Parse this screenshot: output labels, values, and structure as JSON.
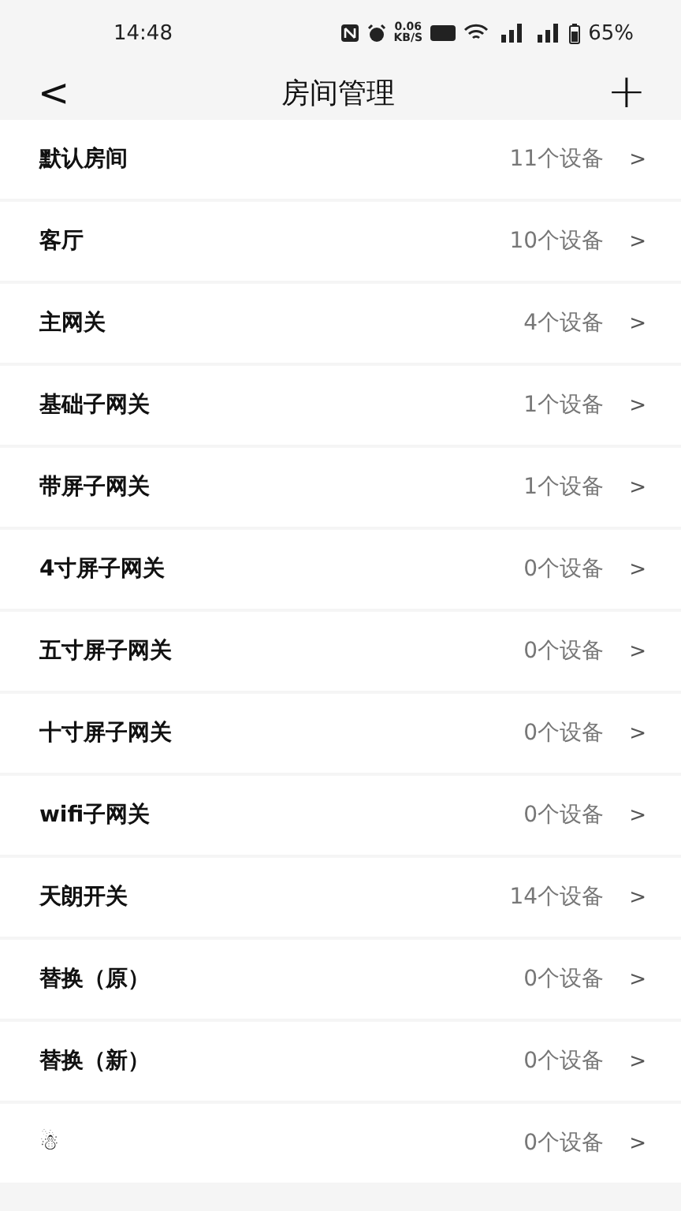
{
  "status_bar": {
    "time": "14:48",
    "speed": "0.06",
    "speed_unit": "KB/S",
    "battery": "65%"
  },
  "header": {
    "back": "<",
    "title": "房间管理",
    "add": "+"
  },
  "rooms": [
    {
      "name": "默认房间",
      "count": "11个设备",
      "chevron": ">"
    },
    {
      "name": "客厅",
      "count": "10个设备",
      "chevron": ">"
    },
    {
      "name": "主网关",
      "count": "4个设备",
      "chevron": ">"
    },
    {
      "name": "基础子网关",
      "count": "1个设备",
      "chevron": ">"
    },
    {
      "name": "带屏子网关",
      "count": "1个设备",
      "chevron": ">"
    },
    {
      "name": "4寸屏子网关",
      "count": "0个设备",
      "chevron": ">"
    },
    {
      "name": "五寸屏子网关",
      "count": "0个设备",
      "chevron": ">"
    },
    {
      "name": "十寸屏子网关",
      "count": "0个设备",
      "chevron": ">"
    },
    {
      "name": "wifi子网关",
      "count": "0个设备",
      "chevron": ">"
    },
    {
      "name": "天朗开关",
      "count": "14个设备",
      "chevron": ">"
    },
    {
      "name": "替换（原）",
      "count": "0个设备",
      "chevron": ">"
    },
    {
      "name": "替换（新）",
      "count": "0个设备",
      "chevron": ">"
    },
    {
      "name": "☃",
      "count": "0个设备",
      "chevron": ">"
    }
  ]
}
